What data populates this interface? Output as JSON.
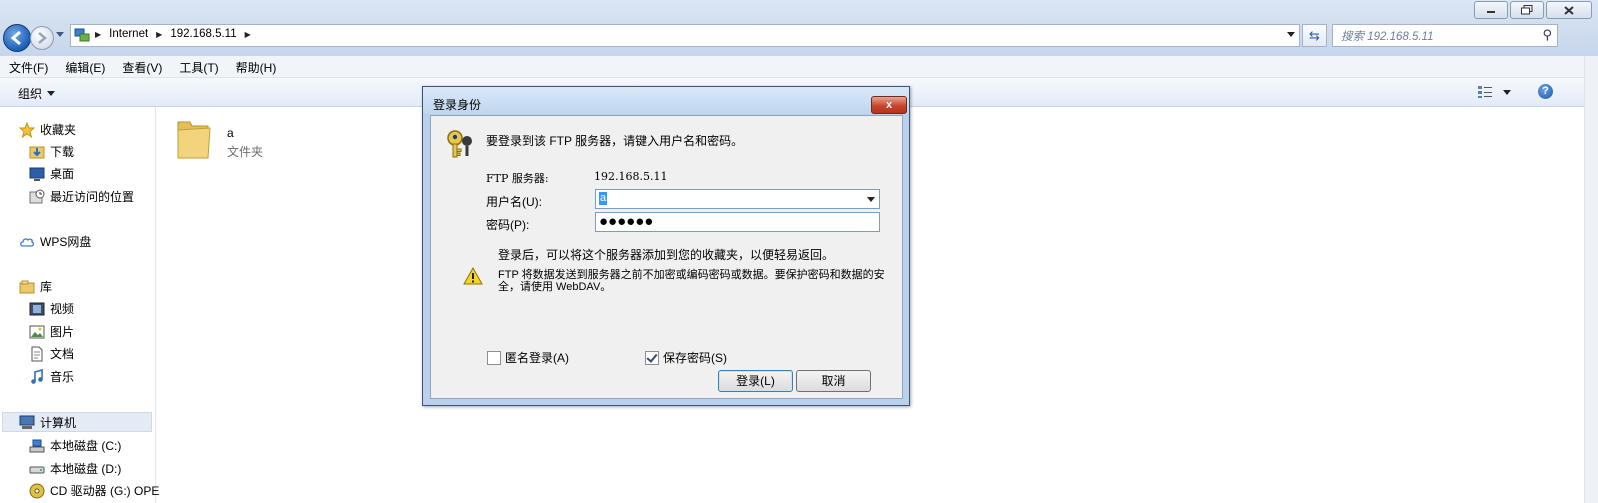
{
  "window": {
    "controls": [
      "minimize",
      "restore",
      "close"
    ]
  },
  "address": {
    "crumbs": [
      "Internet",
      "192.168.5.11"
    ],
    "search_placeholder": "搜索 192.168.5.11"
  },
  "menu": [
    "文件(F)",
    "编辑(E)",
    "查看(V)",
    "工具(T)",
    "帮助(H)"
  ],
  "toolbar": {
    "organize_label": "组织"
  },
  "nav": {
    "favorites": "收藏夹",
    "downloads": "下载",
    "desktop": "桌面",
    "recent": "最近访问的位置",
    "wps": "WPS网盘",
    "libraries": "库",
    "videos": "视频",
    "pictures": "图片",
    "documents": "文档",
    "music": "音乐",
    "computer": "计算机",
    "drive_c": "本地磁盘 (C:)",
    "drive_d": "本地磁盘 (D:)",
    "drive_g": "CD 驱动器 (G:) OPE"
  },
  "content": {
    "folder_name": "a",
    "folder_type": "文件夹"
  },
  "dialog": {
    "title": "登录身份",
    "close_label": "x",
    "prompt": "要登录到该 FTP 服务器，请键入用户名和密码。",
    "server_label": "FTP 服务器:",
    "server_value": "192.168.5.11",
    "user_label": "用户名(U):",
    "user_value": "a",
    "password_label": "密码(P):",
    "password_value": "●●●●●●",
    "note": "登录后，可以将这个服务器添加到您的收藏夹，以便轻易返回。",
    "warning": "FTP 将数据发送到服务器之前不加密或编码密码或数据。要保护密码和数据的安全，请使用 WebDAV。",
    "anonymous_label": "匿名登录(A)",
    "anonymous_checked": false,
    "save_password_label": "保存密码(S)",
    "save_password_checked": true,
    "login_button": "登录(L)",
    "cancel_button": "取消"
  }
}
